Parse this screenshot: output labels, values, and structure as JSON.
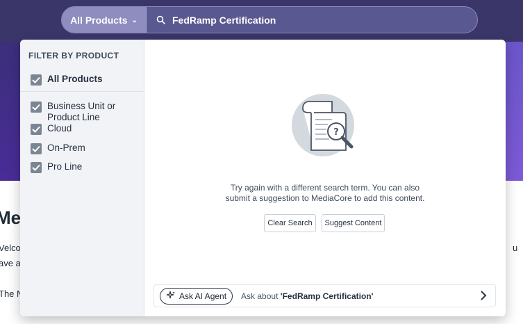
{
  "search": {
    "scope_label": "All Products",
    "query": "FedRamp Certification",
    "placeholder": ""
  },
  "filter": {
    "title": "FILTER BY PRODUCT",
    "items": [
      {
        "label": "All Products",
        "checked": true
      },
      {
        "label": "Business Unit or Product Line",
        "checked": true
      },
      {
        "label": "Cloud",
        "checked": true
      },
      {
        "label": "On-Prem",
        "checked": true
      },
      {
        "label": "Pro Line",
        "checked": true
      }
    ]
  },
  "empty_state": {
    "message_line1": "Try again with a different search term. You can also",
    "message_line2": "submit a suggestion to MediaCore to add this content.",
    "clear_button": "Clear Search",
    "suggest_button": "Suggest Content"
  },
  "ai": {
    "button_label": "Ask AI Agent",
    "ask_prefix": "Ask about ",
    "ask_query": "'FedRamp Certification'"
  },
  "background": {
    "title_fragment": "Mec",
    "line1": "Velco",
    "line2": "ave a",
    "line3": "The N",
    "right_fragment": "u"
  },
  "colors": {
    "header": "#3a3669",
    "hero": "#4a2c9a",
    "scope_button": "#8f8cbf",
    "checkbox": "#7b8593"
  }
}
